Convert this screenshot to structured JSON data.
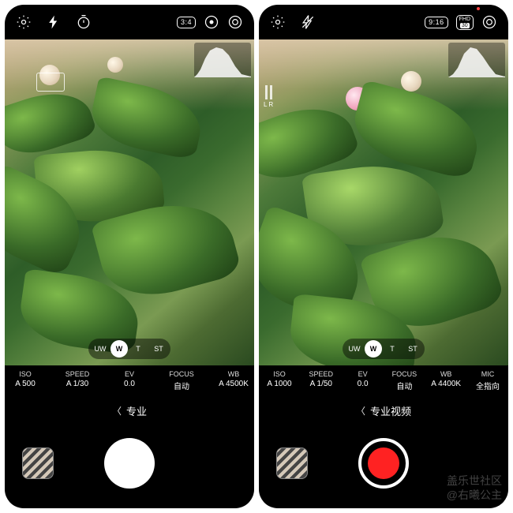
{
  "left": {
    "top_ratio": "3:4",
    "zoom": {
      "options": [
        "UW",
        "W",
        "T",
        "ST"
      ],
      "active_index": 1
    },
    "params": [
      {
        "label": "ISO",
        "value": "A 500"
      },
      {
        "label": "SPEED",
        "value": "A 1/30"
      },
      {
        "label": "EV",
        "value": "0.0"
      },
      {
        "label": "FOCUS",
        "value": "自动"
      },
      {
        "label": "WB",
        "value": "A 4500K"
      }
    ],
    "mode": "专业"
  },
  "right": {
    "top_ratio": "9:16",
    "top_quality": "FHD",
    "top_fps": "30",
    "level_labels": "L   R",
    "zoom": {
      "options": [
        "UW",
        "W",
        "T",
        "ST"
      ],
      "active_index": 1
    },
    "params": [
      {
        "label": "ISO",
        "value": "A 1000"
      },
      {
        "label": "SPEED",
        "value": "A 1/50"
      },
      {
        "label": "EV",
        "value": "0.0"
      },
      {
        "label": "FOCUS",
        "value": "自动"
      },
      {
        "label": "WB",
        "value": "A 4400K"
      },
      {
        "label": "MIC",
        "value": "全指向"
      }
    ],
    "mode": "专业视频"
  },
  "watermark": {
    "line1": "盖乐世社区",
    "line2": "@右曦公主"
  }
}
